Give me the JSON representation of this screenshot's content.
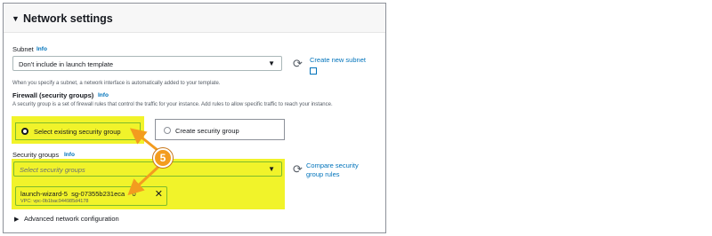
{
  "header": {
    "title": "Network settings",
    "caret": "▼"
  },
  "subnet": {
    "label": "Subnet",
    "info": "Info",
    "selected": "Don't include in launch template",
    "hint": "When you specify a subnet, a network interface is automatically added to your template.",
    "create_link": "Create new subnet"
  },
  "firewall": {
    "label": "Firewall (security groups)",
    "info": "Info",
    "description": "A security group is a set of firewall rules that control the traffic for your instance. Add rules to allow specific traffic to reach your instance.",
    "options": [
      {
        "label": "Select existing security group",
        "selected": true
      },
      {
        "label": "Create security group",
        "selected": false
      }
    ]
  },
  "security_groups": {
    "label": "Security groups",
    "info": "Info",
    "placeholder": "Select security groups",
    "compare_link": "Compare security group rules",
    "token": {
      "name": "launch-wizard-5",
      "id": "sg-07355b231eca",
      "id_tail": "0",
      "vpc": "VPC: vpc-0b1bac944985d4178"
    }
  },
  "advanced": {
    "label": "Advanced network configuration",
    "caret": "▶"
  },
  "annotation": {
    "step": "5"
  },
  "colors": {
    "highlight": "#f1f32a",
    "callout": "#f39c1f",
    "link": "#0073bb",
    "selected_border": "#7dbb2c"
  },
  "icons": {
    "refresh": "refresh-icon",
    "external": "external-link-icon",
    "remove": "close-icon",
    "dropdown": "caret-down-icon"
  }
}
